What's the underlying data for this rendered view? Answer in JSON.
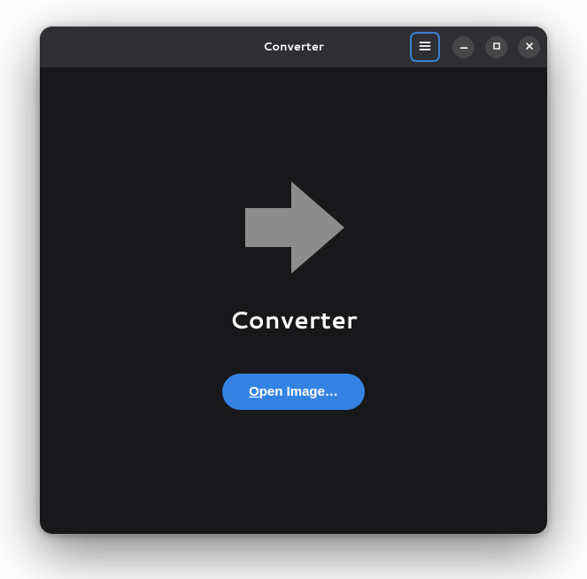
{
  "window": {
    "title": "Converter"
  },
  "content": {
    "heading": "Converter",
    "open_button_mnemonic": "O",
    "open_button_rest": "pen Image…"
  }
}
